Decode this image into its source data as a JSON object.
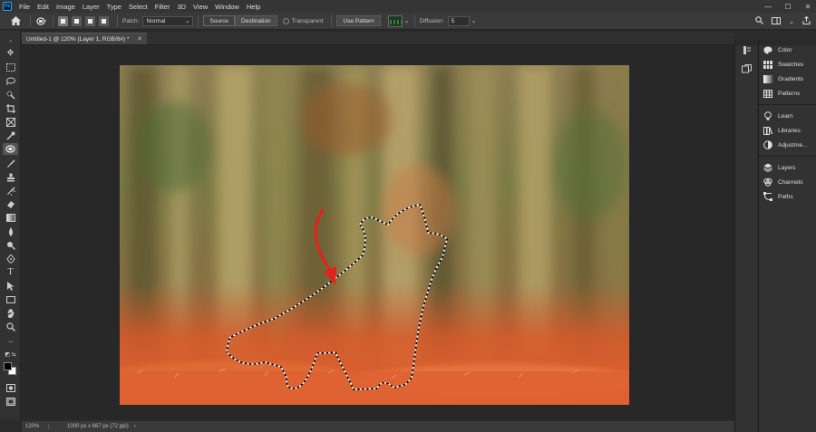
{
  "menubar": {
    "logo": "Ps",
    "items": [
      "File",
      "Edit",
      "Image",
      "Layer",
      "Type",
      "Select",
      "Filter",
      "3D",
      "View",
      "Window",
      "Help"
    ],
    "window_controls": [
      "—",
      "☐",
      "✕"
    ]
  },
  "options": {
    "patch_label": "Patch:",
    "patch_value": "Normal",
    "source_label": "Source",
    "destination_label": "Destination",
    "transparent_label": "Transparent",
    "use_pattern_label": "Use Pattern",
    "diffusion_label": "Diffusion:",
    "diffusion_value": "5"
  },
  "document": {
    "tab_title": "Untitled-1 @ 120% (Layer 1, RGB/8#) *",
    "tab_close": "✕"
  },
  "status": {
    "zoom": "120%",
    "doc_info": "1000 px x 667 px (72 ppi)",
    "arrow": "›"
  },
  "panels": {
    "group1": [
      "Color",
      "Swatches",
      "Gradients",
      "Patterns"
    ],
    "group2": [
      "Learn",
      "Libraries",
      "Adjustme..."
    ],
    "group3": [
      "Layers",
      "Channels",
      "Paths"
    ]
  },
  "colors": {
    "accent_arrow": "#e0241b",
    "foreground": "#000000",
    "background": "#ffffff"
  }
}
